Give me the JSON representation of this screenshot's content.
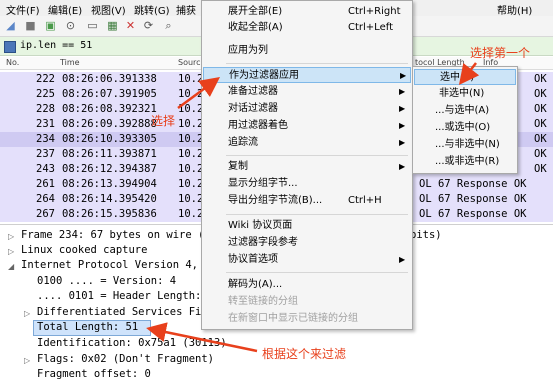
{
  "menubar": [
    "文件(F)",
    "编辑(E)",
    "视图(V)",
    "跳转(G)",
    "捕获",
    "帮助(H)"
  ],
  "filter": {
    "value": "ip.len == 51"
  },
  "columns": {
    "no": "No.",
    "time": "Time",
    "source": "Sourc",
    "proto_len": "tocol Length",
    "info": "Info"
  },
  "packets": [
    {
      "no": "222",
      "time": "08:26:06.391338",
      "src": "10.2",
      "right": "ОК"
    },
    {
      "no": "225",
      "time": "08:26:07.391905",
      "src": "10.2",
      "right": "ОК"
    },
    {
      "no": "228",
      "time": "08:26:08.392321",
      "src": "10.2",
      "right": "ОК"
    },
    {
      "no": "231",
      "time": "08:26:09.392888",
      "src": "10.2",
      "right": "ОК"
    },
    {
      "no": "234",
      "time": "08:26:10.393305",
      "src": "10.2",
      "right": "ОК"
    },
    {
      "no": "237",
      "time": "08:26:11.393871",
      "src": "10.2",
      "right": "ОК"
    },
    {
      "no": "243",
      "time": "08:26:12.394387",
      "src": "10.2",
      "right": "ОК"
    },
    {
      "no": "261",
      "time": "08:26:13.394904",
      "src": "10.2",
      "right": "OL   67 Response OK"
    },
    {
      "no": "264",
      "time": "08:26:14.395420",
      "src": "10.2",
      "right": "OL   67 Response OK"
    },
    {
      "no": "267",
      "time": "08:26:15.395836",
      "src": "10.2",
      "right": "OL   67 Response OK"
    }
  ],
  "details": {
    "frame": "Frame 234: 67 bytes on wire (",
    "frame_tail": "bits)",
    "linux": "Linux cooked capture",
    "ipv4": "Internet Protocol Version 4,",
    "version": "0100 .... = Version: 4",
    "header_length": ".... 0101 = Header Length:",
    "dsf": "Differentiated Services Fie",
    "total_length": "Total Length: 51",
    "identification": "Identification: 0x75a1 (30113)",
    "flags": "Flags: 0x02 (Don't Fragment)",
    "fragment": "Fragment offset: 0"
  },
  "context_menu": {
    "expand_all": {
      "label": "展开全部(E)",
      "shortcut": "Ctrl+Right"
    },
    "collapse_all": {
      "label": "收起全部(A)",
      "shortcut": "Ctrl+Left"
    },
    "apply_as_column": "应用为列",
    "apply_as_filter": "作为过滤器应用",
    "prepare_filter": "准备过滤器",
    "conversation_filter": "对话过滤器",
    "colorize_with_filter": "用过滤器着色",
    "follow_stream": "追踪流",
    "copy": "复制",
    "show_packet_bytes": "显示分组字节...",
    "export_packet_bytes": {
      "label": "导出分组字节流(B)...",
      "shortcut": "Ctrl+H"
    },
    "wiki_page": "Wiki 协议页面",
    "filter_field_reference": "过滤器字段参考",
    "protocol_preferences": "协议首选项",
    "decode_as": "解码为(A)...",
    "go_to_linked_packet": "转至链接的分组",
    "show_linked_packet_new_window": "在新窗口中显示已链接的分组"
  },
  "submenu": [
    "选中(S)",
    "非选中(N)",
    "...与选中(A)",
    "...或选中(O)",
    "...与非选中(N)",
    "...或非选中(R)"
  ],
  "annotations": {
    "select": "选择",
    "select_first": "选择第一个",
    "filter_by_this": "根据这个来过滤"
  },
  "colors": {
    "annotation": "#e8401c",
    "row_bg": "#e4e0fb",
    "filter_bg": "#e6f5e1",
    "highlight": "#cce4f7"
  }
}
